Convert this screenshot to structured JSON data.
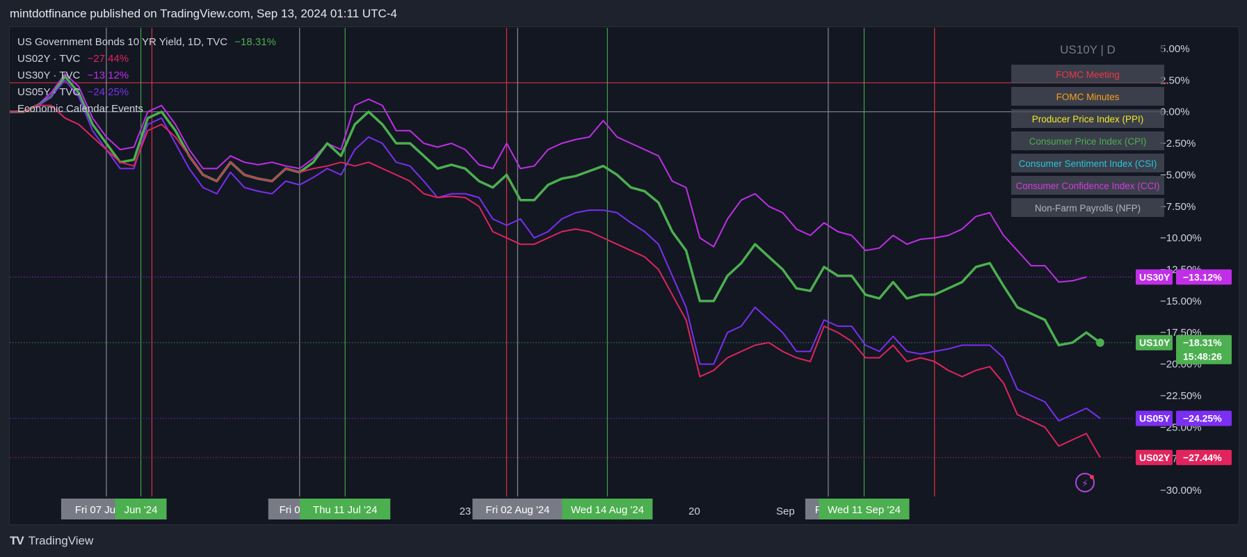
{
  "header": {
    "published": "mintdotfinance published on TradingView.com, Sep 13, 2024 01:11 UTC-4"
  },
  "legend": {
    "main_title": "US Government Bonds 10 YR Yield, 1D, TVC",
    "main_value": "−18.31%",
    "series": [
      {
        "label": "US02Y · TVC",
        "value": "−27.44%",
        "color": "#e0245e"
      },
      {
        "label": "US30Y · TVC",
        "value": "−13.12%",
        "color": "#c02ee8"
      },
      {
        "label": "US05Y · TVC",
        "value": "−24.25%",
        "color": "#7b2ff2"
      }
    ],
    "events_label": "Economic Calendar Events"
  },
  "event_panel": {
    "title": "US10Y | D",
    "items": [
      {
        "label": "FOMC Meeting",
        "color": "#f23645"
      },
      {
        "label": "FOMC Minutes",
        "color": "#f7a21b"
      },
      {
        "label": "Producer Price Index (PPI)",
        "color": "#f5e829"
      },
      {
        "label": "Consumer Price Index (CPI)",
        "color": "#4caf50"
      },
      {
        "label": "Consumer Sentiment Index (CSI)",
        "color": "#26c6da"
      },
      {
        "label": "Consumer Confidence Index (CCI)",
        "color": "#d63be0"
      },
      {
        "label": "Non-Farm Payrolls (NFP)",
        "color": "#b2b5be"
      }
    ]
  },
  "footer": {
    "brand": "TradingView",
    "logo": "TV"
  },
  "chart_data": {
    "type": "line",
    "ylim": [
      -31.5,
      7
    ],
    "y_ticks": [
      5,
      2.5,
      0,
      -2.5,
      -5,
      -7.5,
      -10,
      -12.5,
      -15,
      -17.5,
      -20,
      -22.5,
      -25,
      -27.5,
      -30
    ],
    "y_tick_labels": [
      "5.00%",
      "2.50%",
      "0.00%",
      "−2.50%",
      "−5.00%",
      "−7.50%",
      "−10.00%",
      "−12.50%",
      "−15.00%",
      "−17.50%",
      "−20.00%",
      "−22.50%",
      "−25.00%",
      "−27.50%",
      "−30.00%"
    ],
    "x_labels": [
      {
        "text": "Jun",
        "i": 5.5
      },
      {
        "text": "Jul",
        "i": 25
      },
      {
        "text": "23",
        "i": 41
      },
      {
        "text": "20",
        "i": 61
      },
      {
        "text": "Sep",
        "i": 69
      }
    ],
    "x_count": 78,
    "series": [
      {
        "name": "US30Y",
        "color": "#c02ee8",
        "width": 2,
        "badge": "−13.12%",
        "values": [
          0,
          0,
          0.5,
          1.5,
          3,
          2,
          -0.5,
          -2,
          -3,
          -2.8,
          0,
          0.5,
          -1,
          -3,
          -4.5,
          -4.5,
          -3.5,
          -4,
          -4.2,
          -4,
          -4.3,
          -4.5,
          -3.7,
          -2.5,
          -3,
          0.5,
          1,
          0.5,
          -1.5,
          -1.5,
          -2.5,
          -2.8,
          -2.5,
          -3,
          -4.2,
          -4.5,
          -2.5,
          -4.5,
          -4.3,
          -3,
          -2.5,
          -2.2,
          -2,
          -0.7,
          -2,
          -2.5,
          -3,
          -3.5,
          -5.5,
          -6,
          -10,
          -10.7,
          -8.5,
          -7,
          -6.5,
          -7.5,
          -8,
          -9.3,
          -9.8,
          -8.8,
          -9.5,
          -9.8,
          -11,
          -10.8,
          -9.8,
          -10.5,
          -10.1,
          -10,
          -9.8,
          -9.3,
          -8.3,
          -8,
          -9.8,
          -11,
          -12.2,
          -12.2,
          -13.5,
          -13.4,
          -13.1
        ]
      },
      {
        "name": "US10Y",
        "color": "#4caf50",
        "width": 3.5,
        "badge": "−18.31%",
        "values": [
          0,
          0,
          0.5,
          1.2,
          2.8,
          1.5,
          -1,
          -2.5,
          -4,
          -3.8,
          -0.5,
          0,
          -1.5,
          -3.5,
          -5,
          -5.5,
          -4,
          -5,
          -5.3,
          -5.5,
          -4.5,
          -4.8,
          -4,
          -2.5,
          -3.5,
          -1,
          0,
          -1,
          -2.5,
          -2.5,
          -3.5,
          -4.5,
          -4.2,
          -4.5,
          -5.5,
          -6,
          -5,
          -7,
          -7,
          -5.8,
          -5.3,
          -5.1,
          -4.7,
          -4.3,
          -5,
          -6,
          -6.3,
          -7.2,
          -9.5,
          -11,
          -15,
          -15,
          -13,
          -12,
          -10.5,
          -11.5,
          -12.5,
          -14,
          -14.2,
          -12.3,
          -13,
          -13,
          -14.5,
          -14.8,
          -13.5,
          -14.8,
          -14.5,
          -14.5,
          -14,
          -13.5,
          -12.3,
          -12,
          -13.8,
          -15.5,
          -16,
          -16.5,
          -18.5,
          -18.3,
          -17.5,
          -18.3
        ]
      },
      {
        "name": "US05Y",
        "color": "#7b2ff2",
        "width": 2,
        "badge": "−24.25%",
        "values": [
          0,
          0,
          0.5,
          1.2,
          2.5,
          1.2,
          -1.5,
          -3,
          -4.5,
          -4.5,
          -1,
          -0.5,
          -2.5,
          -4.5,
          -6,
          -6.5,
          -4.8,
          -6,
          -6.3,
          -6.5,
          -5.5,
          -5.8,
          -5.2,
          -4.5,
          -5,
          -3,
          -2,
          -2.5,
          -4,
          -4.3,
          -5.5,
          -6.8,
          -6.5,
          -6.5,
          -6.8,
          -8.5,
          -9,
          -8.5,
          -10,
          -9.5,
          -8.5,
          -8,
          -7.8,
          -7.8,
          -8,
          -8.8,
          -9.5,
          -10.5,
          -13,
          -15.5,
          -20,
          -20,
          -17.5,
          -17,
          -15.5,
          -16.5,
          -17.5,
          -19,
          -19,
          -16.5,
          -17,
          -17,
          -18.5,
          -19,
          -17.8,
          -19,
          -19.2,
          -19,
          -18.8,
          -18.5,
          -18.5,
          -18.5,
          -19.5,
          -22,
          -22.5,
          -23,
          -24.5,
          -24,
          -23.5,
          -24.3
        ]
      },
      {
        "name": "US02Y",
        "color": "#e0245e",
        "width": 2,
        "badge": "−27.44%",
        "values": [
          0,
          0,
          0.5,
          0.5,
          -0.5,
          -1,
          -2,
          -3,
          -4,
          -4.3,
          -1.5,
          -1,
          -2,
          -3.5,
          -5,
          -5.5,
          -4,
          -5,
          -5.3,
          -5.5,
          -4.5,
          -4.8,
          -4.5,
          -4.3,
          -4,
          -4.3,
          -4,
          -4.5,
          -5,
          -5.5,
          -6.5,
          -6.8,
          -6.7,
          -6.8,
          -7.5,
          -9.5,
          -10,
          -10.5,
          -10.5,
          -10,
          -9.5,
          -9.3,
          -9.5,
          -10,
          -10.5,
          -11,
          -11.5,
          -12.5,
          -14.5,
          -16.5,
          -21,
          -20.5,
          -19.5,
          -19,
          -18.5,
          -18.3,
          -19,
          -19.5,
          -19.8,
          -17,
          -17.5,
          -18.2,
          -19.5,
          -19.5,
          -18.5,
          -19.8,
          -19.5,
          -19.8,
          -20.5,
          -21,
          -20.5,
          -20.2,
          -21.5,
          -24,
          -24.5,
          -25,
          -26.5,
          -26,
          -25.5,
          -27.4
        ]
      }
    ],
    "hlines": [
      {
        "y": 2.3,
        "color": "#f23645",
        "dash": "none"
      },
      {
        "y": 0,
        "color": "#9598a1",
        "dash": "none"
      }
    ],
    "events": [
      {
        "i": 7,
        "color": "#9598a1",
        "label": "Fri 07 Jun '24",
        "label_bg": "#787b86",
        "label_dx": 0
      },
      {
        "i": 9.5,
        "color": "#4caf50",
        "label": "Jun '24",
        "label_bg": "#4caf50",
        "label_dx": 0
      },
      {
        "i": 10.3,
        "color": "#f23645",
        "label": "",
        "label_bg": "",
        "label_dx": 0
      },
      {
        "i": 21,
        "color": "#9598a1",
        "label": "Fri 05 Ju",
        "label_bg": "#787b86",
        "label_dx": 0
      },
      {
        "i": 24.3,
        "color": "#4caf50",
        "label": "Thu 11 Jul '24",
        "label_bg": "#4caf50",
        "label_dx": 0
      },
      {
        "i": 36,
        "color": "#f23645",
        "label": "",
        "label_bg": "",
        "label_dx": 0
      },
      {
        "i": 36.8,
        "color": "#9598a1",
        "label": "Fri 02 Aug '24",
        "label_bg": "#787b86",
        "label_dx": 0
      },
      {
        "i": 43.3,
        "color": "#4caf50",
        "label": "Wed 14 Aug '24",
        "label_bg": "#4caf50",
        "label_dx": 0
      },
      {
        "i": 59.3,
        "color": "#9598a1",
        "label": "Fri 06",
        "label_bg": "#787b86",
        "label_dx": 0
      },
      {
        "i": 61.9,
        "color": "#4caf50",
        "label": "Wed 11 Sep '24",
        "label_bg": "#4caf50",
        "label_dx": 0
      },
      {
        "i": 67,
        "color": "#f23645",
        "label": "",
        "label_bg": "",
        "label_dx": 0
      }
    ],
    "x_label_overlay": [
      {
        "text": "Jun",
        "i": 4.6
      },
      {
        "text": "Jul",
        "i": 20.2
      },
      {
        "text": "23",
        "i": 33
      },
      {
        "text": "20",
        "i": 49.6
      },
      {
        "text": "Sep",
        "i": 56.2
      }
    ]
  }
}
